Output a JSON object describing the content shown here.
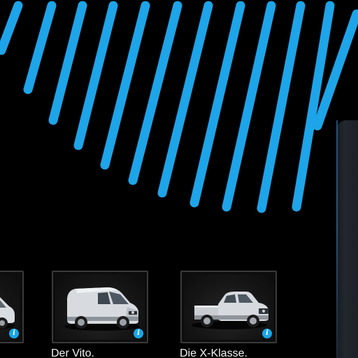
{
  "colors": {
    "background": "#000000",
    "stripe_blue": "#1ea4e8",
    "info_badge": "#1aa5e6",
    "card_border": "#3a3a3a",
    "title_text": "#f2f2f2"
  },
  "vehicle_carousel": {
    "cards": [
      {
        "title": "",
        "vehicle_icon": "van-icon",
        "info_icon": "info-icon",
        "info_symbol": "i",
        "partially_visible": true
      },
      {
        "title": "Der Vito.",
        "vehicle_icon": "van-icon",
        "info_icon": "info-icon",
        "info_symbol": "i",
        "partially_visible": false
      },
      {
        "title": "Die X-Klasse.",
        "vehicle_icon": "pickup-truck-icon",
        "info_icon": "info-icon",
        "info_symbol": "i",
        "partially_visible": false
      }
    ]
  }
}
